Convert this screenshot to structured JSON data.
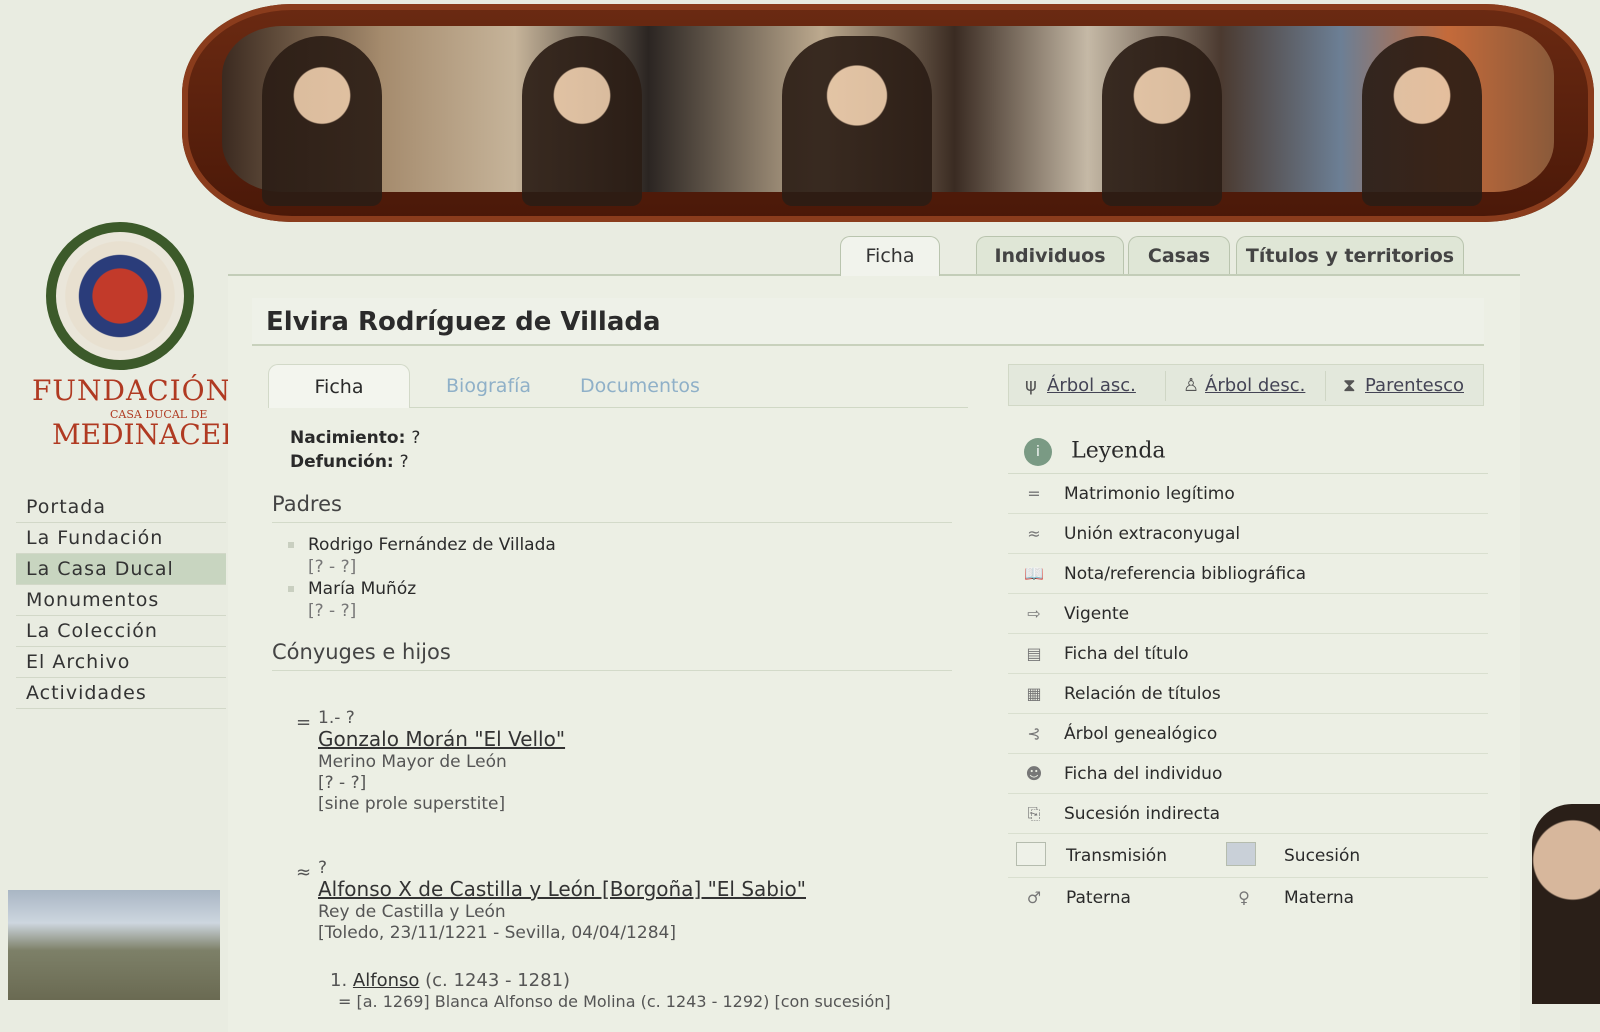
{
  "brand": {
    "line1": "FUNDACIÓN",
    "line2": "CASA DUCAL DE",
    "line3": "MEDINACELI"
  },
  "left_nav": [
    {
      "label": "Portada",
      "active": false
    },
    {
      "label": "La Fundación",
      "active": false
    },
    {
      "label": "La Casa Ducal",
      "active": true
    },
    {
      "label": "Monumentos",
      "active": false
    },
    {
      "label": "La Colección",
      "active": false
    },
    {
      "label": "El Archivo",
      "active": false
    },
    {
      "label": "Actividades",
      "active": false
    }
  ],
  "top_tabs": [
    {
      "label": "Ficha",
      "active": true
    },
    {
      "label": "Individuos",
      "active": false
    },
    {
      "label": "Casas",
      "active": false
    },
    {
      "label": "Títulos y territorios",
      "active": false
    }
  ],
  "person": {
    "name": "Elvira Rodríguez de Villada"
  },
  "inner_tabs": [
    {
      "label": "Ficha",
      "active": true
    },
    {
      "label": "Biografía",
      "active": false
    },
    {
      "label": "Documentos",
      "active": false
    }
  ],
  "vitals": {
    "birth_label": "Nacimiento:",
    "birth_value": "?",
    "death_label": "Defunción:",
    "death_value": "?"
  },
  "sections": {
    "parents": "Padres",
    "spouses": "Cónyuges e hijos"
  },
  "parents": [
    {
      "name": "Rodrigo Fernández de Villada",
      "dates": "[? - ?]"
    },
    {
      "name": "María Muñóz",
      "dates": "[? - ?]"
    }
  ],
  "spouses": [
    {
      "symbol": "=",
      "order": "1.- ?",
      "name": "Gonzalo Morán \"El Vello\"",
      "title": "Merino Mayor de León",
      "dates": "[? - ?]",
      "note": "[sine prole superstite]"
    },
    {
      "symbol": "≈",
      "order": "?",
      "name": "Alfonso X de Castilla y León [Borgoña] \"El Sabio\"",
      "title": "Rey de Castilla y León",
      "dates": "[Toledo, 23/11/1221 - Sevilla, 04/04/1284]"
    }
  ],
  "children": [
    {
      "prefix": "1.",
      "name": "Alfonso",
      "dates": "(c. 1243 - 1281)",
      "marriage": "= [a. 1269] Blanca Alfonso de Molina (c. 1243 - 1292) [con sucesión]"
    }
  ],
  "tree_buttons": [
    {
      "label": "Árbol asc.",
      "icon": "tree-ascending-icon"
    },
    {
      "label": "Árbol desc.",
      "icon": "tree-descending-icon"
    },
    {
      "label": "Parentesco",
      "icon": "kinship-icon"
    }
  ],
  "legend": {
    "title": "Leyenda",
    "items": [
      {
        "symbol": "=",
        "label": "Matrimonio legítimo",
        "icon": "equals-icon"
      },
      {
        "symbol": "≈",
        "label": "Unión extraconyugal",
        "icon": "approx-icon"
      },
      {
        "symbol": "📖",
        "label": "Nota/referencia bibliográfica",
        "icon": "book-icon"
      },
      {
        "symbol": "⇨",
        "label": "Vigente",
        "icon": "arrow-right-icon"
      },
      {
        "symbol": "▤",
        "label": "Ficha del título",
        "icon": "title-card-icon"
      },
      {
        "symbol": "▦",
        "label": "Relación de títulos",
        "icon": "title-list-icon"
      },
      {
        "symbol": "⊰",
        "label": "Árbol genealógico",
        "icon": "genealogy-tree-icon"
      },
      {
        "symbol": "☻",
        "label": "Ficha del individuo",
        "icon": "person-card-icon"
      },
      {
        "symbol": "⎘",
        "label": "Sucesión indirecta",
        "icon": "indirect-succession-icon"
      }
    ],
    "swatches": [
      {
        "label": "Transmisión",
        "color": "#eef1e8"
      },
      {
        "label": "Sucesión",
        "color": "#c9d0d8"
      }
    ],
    "genders": [
      {
        "symbol": "♂",
        "label": "Paterna"
      },
      {
        "symbol": "♀",
        "label": "Materna"
      }
    ]
  }
}
